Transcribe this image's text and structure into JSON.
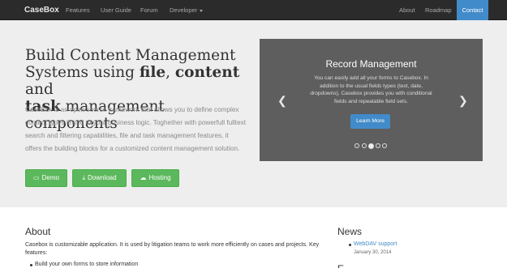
{
  "navbar": {
    "brand": "CaseBox",
    "items": [
      {
        "label": "Features"
      },
      {
        "label": "User Guide"
      },
      {
        "label": "Forum"
      },
      {
        "label": "Developer"
      }
    ],
    "right_items": [
      {
        "label": "About"
      },
      {
        "label": "Roadmap"
      },
      {
        "label": "Contact",
        "active": true
      }
    ],
    "colors": {
      "bg": "#2b2b2b",
      "active": "#428bca"
    }
  },
  "hero": {
    "title_line1": "Build Content Management",
    "title_line2_pre": "Systems using ",
    "title_bold1": "file",
    "title_sep": ", ",
    "title_bold2": "content",
    "title_and": " and",
    "title_bold3": "task",
    "title_line3_post": " management components",
    "description": "CaseBox is an open source framework that allows you to define complex content types linked to your business logic. Toghether with powerfull fulltext search and filtering capabilities, file and task management features, it offers the building blocks for a customized content management solution.",
    "buttons": [
      {
        "label": "Demo",
        "icon": "monitor-icon"
      },
      {
        "label": "Download",
        "icon": "download-icon"
      },
      {
        "label": "Hosting",
        "icon": "cloud-icon"
      }
    ],
    "button_color": "#5cb85c"
  },
  "carousel": {
    "title": "Record Management",
    "text": "You can easily add all your forms to Casebox. In addition to the usual fields types (text, date, dropdowns), Casebox provides you with conditional fields and repeatable field sets.",
    "button_label": "Learn More",
    "prev_icon": "chevron-left-icon",
    "next_icon": "chevron-right-icon",
    "slide_count": 5,
    "active_index": 2
  },
  "about": {
    "title": "About",
    "text": "Casebox is customizable application. It is used by litigation teams to work more efficiently on cases and projects. Key features:",
    "features": [
      "Build your own forms to store information"
    ]
  },
  "news": {
    "title": "News",
    "items": [
      {
        "label": "WebDAV support",
        "date": "January 30, 2014"
      }
    ],
    "next_heading": "E"
  }
}
